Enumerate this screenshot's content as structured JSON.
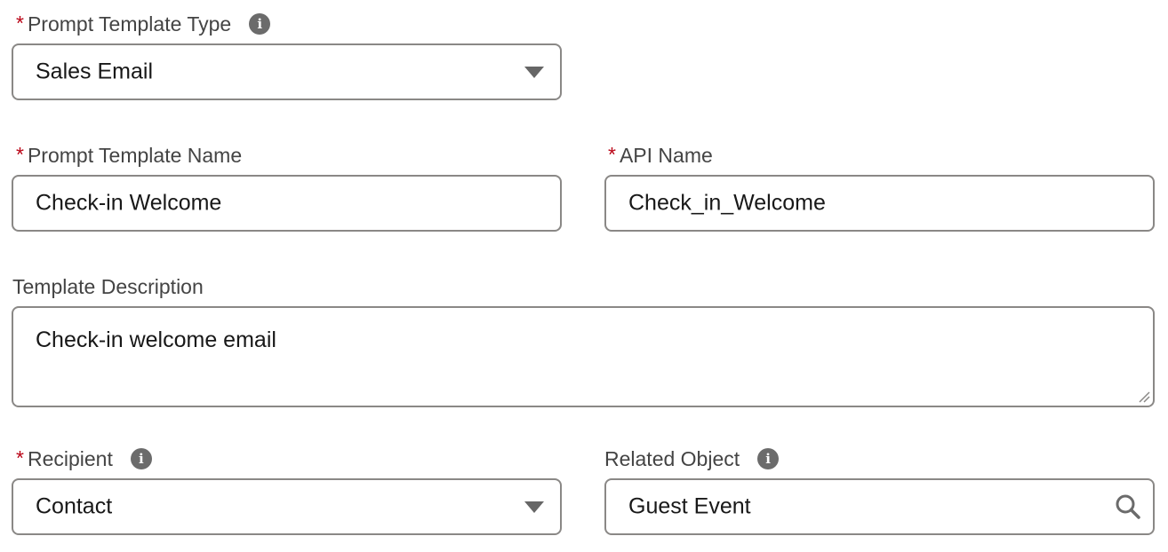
{
  "form": {
    "prompt_template_type": {
      "required_mark": "*",
      "label": "Prompt Template Type",
      "value": "Sales Email",
      "icon": "info-icon"
    },
    "prompt_template_name": {
      "required_mark": "*",
      "label": "Prompt Template Name",
      "value": "Check-in Welcome"
    },
    "api_name": {
      "required_mark": "*",
      "label": "API Name",
      "value": "Check_in_Welcome"
    },
    "template_description": {
      "label": "Template Description",
      "value": "Check-in welcome email"
    },
    "recipient": {
      "required_mark": "*",
      "label": "Recipient",
      "value": "Contact",
      "icon": "info-icon"
    },
    "related_object": {
      "label": "Related Object",
      "value": "Guest Event",
      "icon": "info-icon",
      "trailing_icon": "search-icon"
    }
  },
  "colors": {
    "required": "#ba0517",
    "border": "#8a8886",
    "icon": "#6b6b6b"
  },
  "icons": {
    "info_glyph": "i"
  }
}
